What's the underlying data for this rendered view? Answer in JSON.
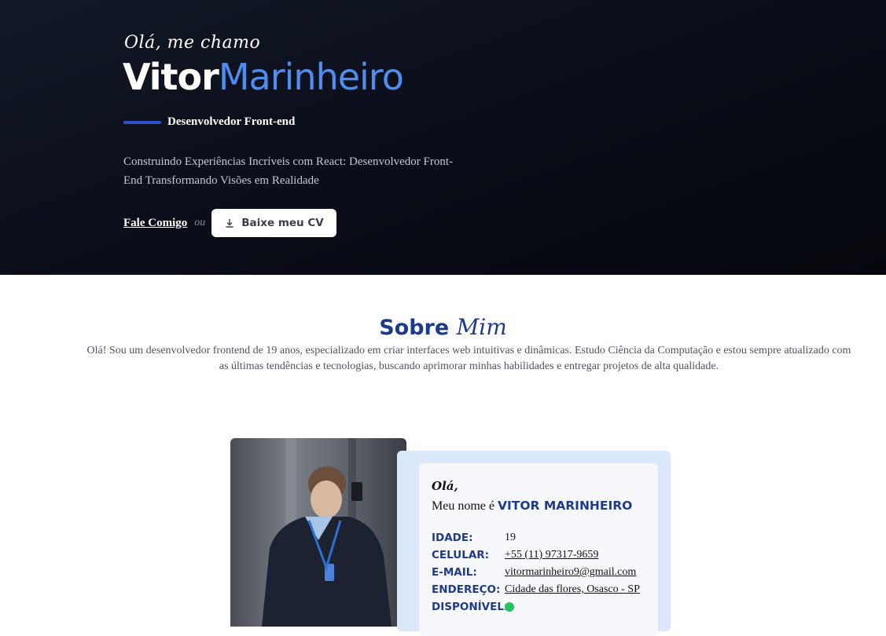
{
  "hero": {
    "greeting": "Olá, me chamo",
    "first_name": "Vitor",
    "last_name": "Marinheiro",
    "role": "Desenvolvedor Front-end",
    "tagline": "Construindo Experiências Incríveis com React: Desenvolvedor Front-End Transformando Visões em Realidade",
    "contact_label": "Fale Comigo",
    "or_label": "ou",
    "cv_button_label": "Baixe meu CV",
    "cv_icon": "download-icon"
  },
  "about": {
    "title_main": "Sobre",
    "title_accent": "Mim",
    "text": "Olá! Sou um desenvolvedor frontend de 19 anos, especializado em criar interfaces web intuitivas e dinâmicas. Estudo Ciência da Computação e estou sempre atualizado com as últimas tendências e tecnologias, buscando aprimorar minhas habilidades e entregar projetos de alta qualidade."
  },
  "profile": {
    "hello": "Olá,",
    "name_prefix": "Meu nome é",
    "name": "VITOR MARINHEIRO",
    "fields": {
      "age": {
        "label": "IDADE:",
        "value": "19"
      },
      "phone": {
        "label": "CELULAR:",
        "value": "+55 (11) 97317-9659"
      },
      "email": {
        "label": "E-MAIL:",
        "value": "vitormarinheiro9@gmail.com"
      },
      "address": {
        "label": "ENDEREÇO:",
        "value": "Cidade das flores, Osasco - SP"
      },
      "available": {
        "label": "DISPONÍVEL:"
      }
    }
  },
  "colors": {
    "accent_blue": "#4f8ef0",
    "navy": "#1e3a8a",
    "status_available": "#22c55e"
  }
}
